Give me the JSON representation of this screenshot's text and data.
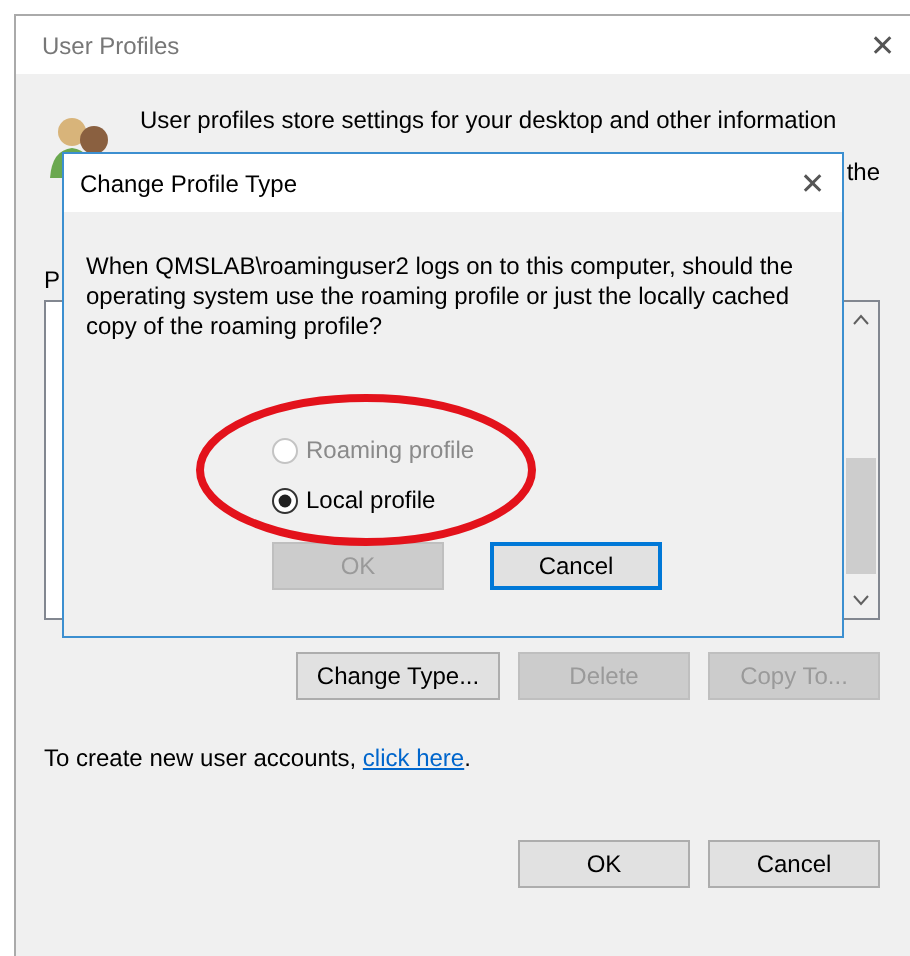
{
  "window": {
    "title": "User Profiles",
    "close": "✕"
  },
  "description": {
    "line1": "User profiles store settings for your desktop and other information",
    "visible_end": "the"
  },
  "list_label": "P",
  "buttons": [
    {
      "label": "Change Type...",
      "disabled": false
    },
    {
      "label": "Delete",
      "disabled": true
    },
    {
      "label": "Copy To...",
      "disabled": true
    }
  ],
  "link_sentence": {
    "before": "To create new user accounts, ",
    "link": "click here",
    "after": "."
  },
  "footer_buttons": [
    {
      "label": "OK"
    },
    {
      "label": "Cancel"
    }
  ],
  "dialog": {
    "title": "Change Profile Type",
    "close": "✕",
    "message": "When QMSLAB\\roaminguser2 logs on to this computer, should the operating system use the roaming profile or just the locally cached copy of the roaming profile?",
    "options": [
      {
        "label": "Roaming profile",
        "selected": false,
        "disabled": true
      },
      {
        "label": "Local profile",
        "selected": true,
        "disabled": false
      }
    ],
    "buttons": [
      {
        "label": "OK",
        "disabled": true,
        "focused": false
      },
      {
        "label": "Cancel",
        "disabled": false,
        "focused": true
      }
    ]
  }
}
